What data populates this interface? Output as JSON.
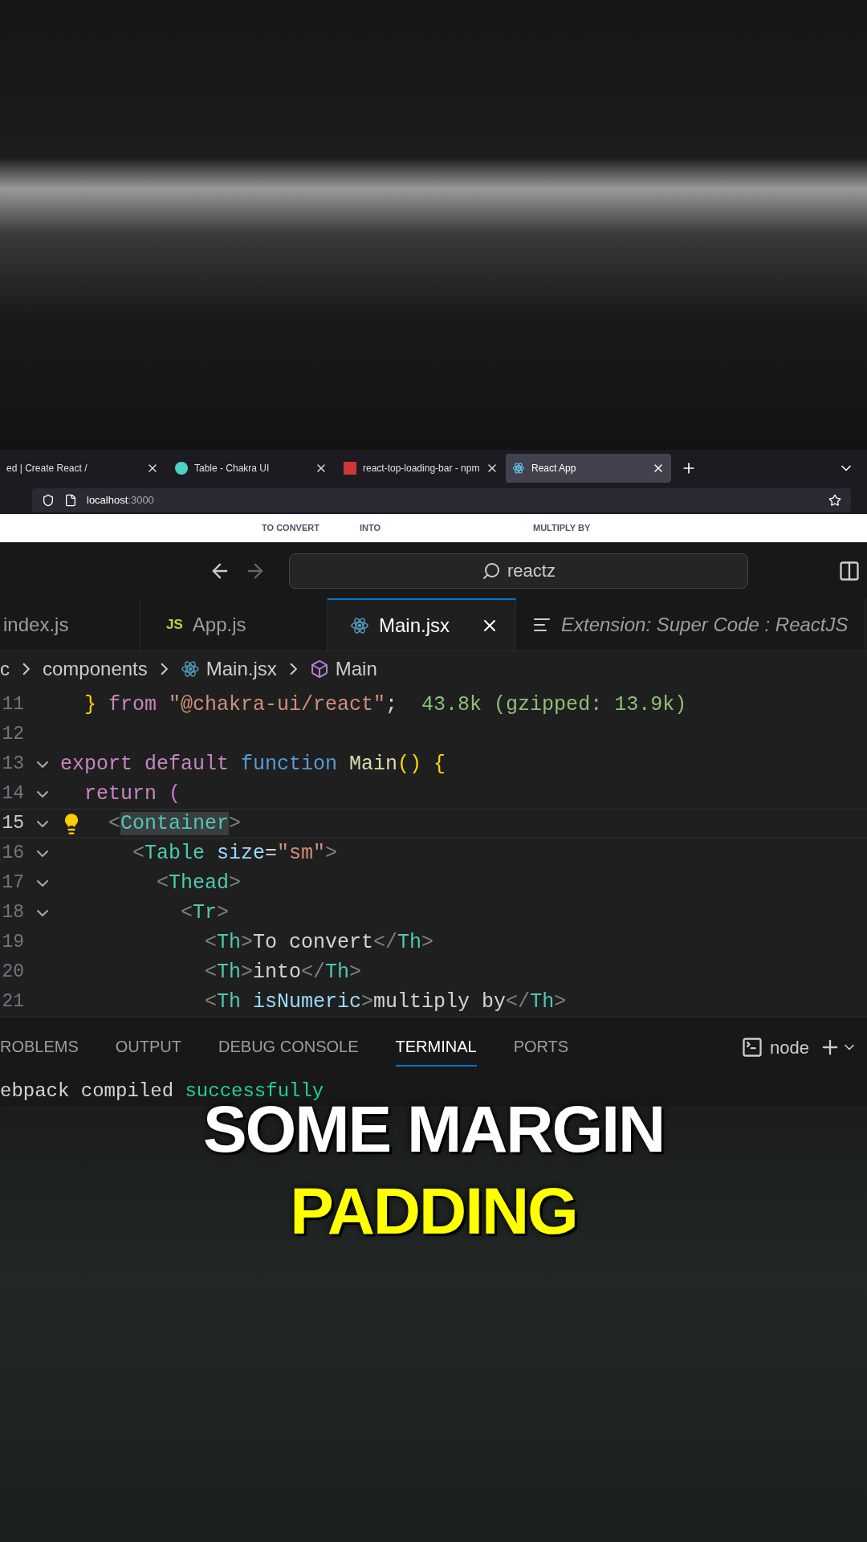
{
  "browser": {
    "tabs": [
      {
        "label": "ed | Create React /",
        "selected": false
      },
      {
        "label": "Table - Chakra UI",
        "selected": false
      },
      {
        "label": "react-top-loading-bar - npm",
        "selected": false
      },
      {
        "label": "React App",
        "selected": true
      }
    ],
    "address": {
      "host": "localhost",
      "port": ":3000"
    },
    "page_headers": [
      "TO CONVERT",
      "INTO",
      "MULTIPLY BY"
    ]
  },
  "editor": {
    "search": "reactz",
    "tabs": [
      {
        "label": "index.js",
        "selected": false,
        "italic": false
      },
      {
        "label": "App.js",
        "icon_text": "JS",
        "selected": false,
        "italic": false
      },
      {
        "label": "Main.jsx",
        "selected": true,
        "italic": false
      },
      {
        "label": "Extension: Super Code : ReactJS",
        "selected": false,
        "italic": true
      }
    ],
    "breadcrumb": [
      "c",
      "components",
      "Main.jsx",
      "Main"
    ],
    "lines": [
      {
        "number": "11",
        "fold": false,
        "current": false,
        "bulb": false,
        "segments": [
          {
            "t": "}",
            "kind": "brace"
          },
          {
            "t": " from ",
            "kind": "keyword"
          },
          {
            "t": "\"@chakra-ui/react\"",
            "kind": "string"
          },
          {
            "t": ";  ",
            "kind": "plain"
          },
          {
            "t": "43.8k (gzipped: 13.9k)",
            "kind": "hint"
          }
        ]
      },
      {
        "number": "12",
        "fold": false,
        "current": false,
        "bulb": false
      },
      {
        "number": "13",
        "fold": true,
        "current": false,
        "bulb": false,
        "segments": [
          {
            "t": "export default ",
            "kind": "keyword"
          },
          {
            "t": "function ",
            "kind": "storage"
          },
          {
            "t": "Main",
            "kind": "fn"
          },
          {
            "t": "() {",
            "kind": "brace"
          }
        ]
      },
      {
        "number": "14",
        "fold": true,
        "current": false,
        "bulb": false,
        "segments": [
          {
            "t": "return ",
            "kind": "keyword"
          },
          {
            "t": "(",
            "kind": "paren"
          }
        ]
      },
      {
        "number": "15",
        "fold": true,
        "current": true,
        "bulb": true,
        "segments": [
          {
            "t": "<",
            "kind": "punct"
          },
          {
            "t": "Container",
            "kind": "tag-selected"
          },
          {
            "t": ">",
            "kind": "punct"
          }
        ]
      },
      {
        "number": "16",
        "fold": true,
        "current": false,
        "bulb": false,
        "segments": [
          {
            "t": "<",
            "kind": "punct"
          },
          {
            "t": "Table",
            "kind": "tag"
          },
          {
            "t": " size",
            "kind": "attr"
          },
          {
            "t": "=",
            "kind": "plain"
          },
          {
            "t": "\"sm\"",
            "kind": "string"
          },
          {
            "t": ">",
            "kind": "punct"
          }
        ]
      },
      {
        "number": "17",
        "fold": true,
        "current": false,
        "bulb": false,
        "segments": [
          {
            "t": "<",
            "kind": "punct"
          },
          {
            "t": "Thead",
            "kind": "tag"
          },
          {
            "t": ">",
            "kind": "punct"
          }
        ]
      },
      {
        "number": "18",
        "fold": true,
        "current": false,
        "bulb": false,
        "segments": [
          {
            "t": "<",
            "kind": "punct"
          },
          {
            "t": "Tr",
            "kind": "tag"
          },
          {
            "t": ">",
            "kind": "punct"
          }
        ]
      },
      {
        "number": "19",
        "fold": false,
        "current": false,
        "bulb": false,
        "segments": [
          {
            "t": "<",
            "kind": "punct"
          },
          {
            "t": "Th",
            "kind": "tag"
          },
          {
            "t": ">",
            "kind": "punct"
          },
          {
            "t": "To convert",
            "kind": "plain"
          },
          {
            "t": "</",
            "kind": "punct"
          },
          {
            "t": "Th",
            "kind": "tag"
          },
          {
            "t": ">",
            "kind": "punct"
          }
        ]
      },
      {
        "number": "20",
        "fold": false,
        "current": false,
        "bulb": false,
        "segments": [
          {
            "t": "<",
            "kind": "punct"
          },
          {
            "t": "Th",
            "kind": "tag"
          },
          {
            "t": ">",
            "kind": "punct"
          },
          {
            "t": "into",
            "kind": "plain"
          },
          {
            "t": "</",
            "kind": "punct"
          },
          {
            "t": "Th",
            "kind": "tag"
          },
          {
            "t": ">",
            "kind": "punct"
          }
        ]
      },
      {
        "number": "21",
        "fold": false,
        "current": false,
        "bulb": false,
        "segments": [
          {
            "t": "<",
            "kind": "punct"
          },
          {
            "t": "Th",
            "kind": "tag"
          },
          {
            "t": " isNumeric",
            "kind": "attr"
          },
          {
            "t": ">",
            "kind": "punct"
          },
          {
            "t": "multiply by",
            "kind": "plain"
          },
          {
            "t": "</",
            "kind": "punct"
          },
          {
            "t": "Th",
            "kind": "tag"
          },
          {
            "t": ">",
            "kind": "punct"
          }
        ]
      }
    ],
    "panel_tabs": [
      {
        "label": "ROBLEMS",
        "selected": false
      },
      {
        "label": "OUTPUT",
        "selected": false
      },
      {
        "label": "DEBUG CONSOLE",
        "selected": false
      },
      {
        "label": "TERMINAL",
        "selected": true
      },
      {
        "label": "PORTS",
        "selected": false
      }
    ],
    "terminal_name": "node",
    "terminal_line": [
      {
        "t": "ebpack compiled ",
        "kind": "plain"
      },
      {
        "t": "successfully",
        "kind": "success"
      }
    ]
  },
  "caption": {
    "line_1": "SOME MARGIN",
    "line_2": "PADDING"
  }
}
